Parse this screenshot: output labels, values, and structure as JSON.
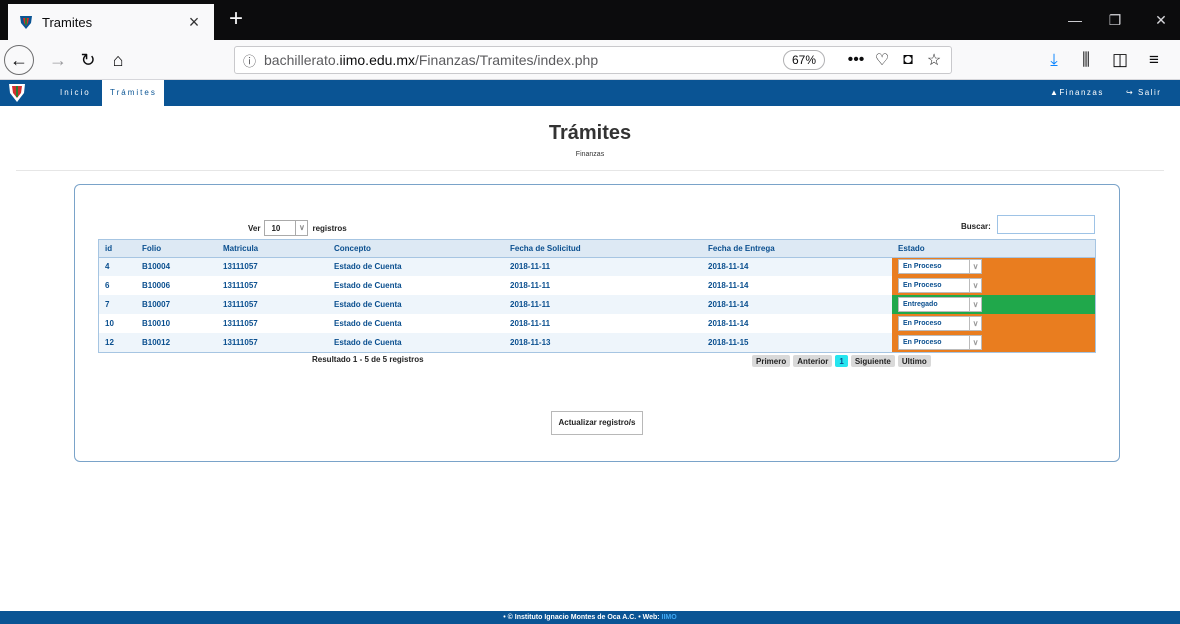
{
  "browser": {
    "tab_title": "Tramites",
    "tab_close": "×",
    "new_tab": "+",
    "url_prefix": "bachillerato.",
    "url_domain": "iimo.edu.mx",
    "url_path": "/Finanzas/Tramites/index.php",
    "zoom": "67%",
    "more": "•••"
  },
  "site_nav": {
    "inicio": "Inicio",
    "tramites": "Trámites",
    "finanzas": "Finanzas",
    "salir": "Salir"
  },
  "page": {
    "title": "Trámites",
    "subtitle": "Finanzas"
  },
  "controls": {
    "ver_label": "Ver",
    "page_size": "10",
    "registros_label": "registros",
    "buscar_label": "Buscar:"
  },
  "table": {
    "headers": [
      "id",
      "Folio",
      "Matricula",
      "Concepto",
      "Fecha de Solicitud",
      "Fecha de Entrega",
      "Estado"
    ],
    "rows": [
      {
        "id": "4",
        "folio": "B10004",
        "matricula": "13111057",
        "concepto": "Estado de Cuenta",
        "solicitud": "2018-11-11",
        "entrega": "2018-11-14",
        "estado": "En Proceso"
      },
      {
        "id": "6",
        "folio": "B10006",
        "matricula": "13111057",
        "concepto": "Estado de Cuenta",
        "solicitud": "2018-11-11",
        "entrega": "2018-11-14",
        "estado": "En Proceso"
      },
      {
        "id": "7",
        "folio": "B10007",
        "matricula": "13111057",
        "concepto": "Estado de Cuenta",
        "solicitud": "2018-11-11",
        "entrega": "2018-11-14",
        "estado": "Entregado"
      },
      {
        "id": "10",
        "folio": "B10010",
        "matricula": "13111057",
        "concepto": "Estado de Cuenta",
        "solicitud": "2018-11-11",
        "entrega": "2018-11-14",
        "estado": "En Proceso"
      },
      {
        "id": "12",
        "folio": "B10012",
        "matricula": "13111057",
        "concepto": "Estado de Cuenta",
        "solicitud": "2018-11-13",
        "entrega": "2018-11-15",
        "estado": "En Proceso"
      }
    ]
  },
  "status_colors": {
    "En Proceso": "#e97d1f",
    "Entregado": "#20a84b"
  },
  "pagination": {
    "resultado": "Resultado 1 - 5 de 5 registros",
    "primero": "Primero",
    "anterior": "Anterior",
    "current": "1",
    "siguiente": "Siguiente",
    "ultimo": "Ultimo"
  },
  "actions": {
    "actualizar": "Actualizar registro/s"
  },
  "footer": {
    "text": "• © Instituto Ignacio Montes de Oca A.C.  • Web: ",
    "web": "IIMO"
  }
}
